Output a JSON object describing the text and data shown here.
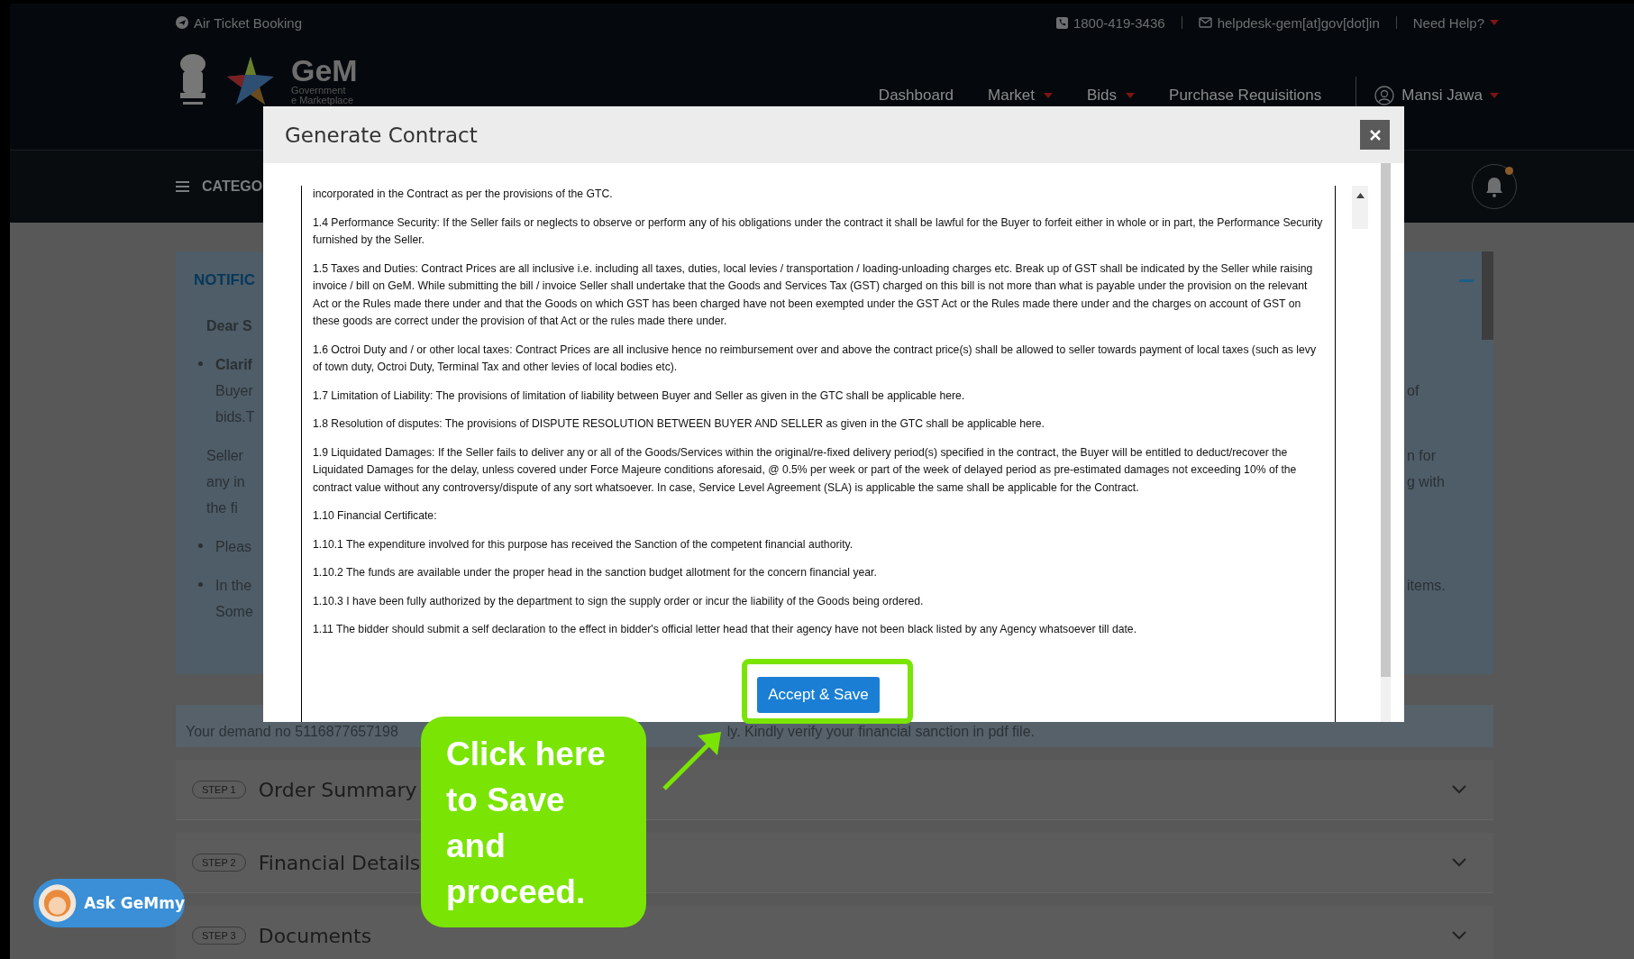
{
  "top_bar": {
    "air_ticket": "Air Ticket Booking",
    "phone": "1800-419-3436",
    "email": "helpdesk-gem[at]gov[dot]in",
    "help": "Need Help?"
  },
  "logo": {
    "name": "GeM",
    "line_1": "Government",
    "line_2": "e Marketplace"
  },
  "nav": [
    {
      "label": "Dashboard",
      "dropdown": false
    },
    {
      "label": "Market",
      "dropdown": true
    },
    {
      "label": "Bids",
      "dropdown": true
    },
    {
      "label": "Purchase Requisitions",
      "dropdown": false
    }
  ],
  "user": {
    "name": "Mansi Jawa"
  },
  "category_bar": {
    "label": "CATEGO"
  },
  "notifications": {
    "title": "NOTIFIC",
    "items": [
      {
        "kind": "greeting",
        "lines": [
          {
            "left": "Dear S"
          }
        ]
      },
      {
        "kind": "bullet",
        "heading": "Clarif",
        "lines": [
          {
            "left": "Buyer",
            "right": "of"
          },
          {
            "left": "bids.T"
          }
        ]
      },
      {
        "kind": "paragraph",
        "lines": [
          {
            "left": "Seller",
            "right": "n for"
          },
          {
            "left": "any in",
            "right": "g with"
          },
          {
            "left": "the fi"
          }
        ]
      },
      {
        "kind": "bullet",
        "lines": [
          {
            "left": "Pleas"
          }
        ]
      },
      {
        "kind": "bullet",
        "lines": [
          {
            "left": "In the",
            "right": "items."
          },
          {
            "left": "Some"
          }
        ]
      }
    ]
  },
  "demand": {
    "start": "Your demand no 5116877657198",
    "end": "ly. Kindly verify your financial sanction in pdf file."
  },
  "steps": [
    {
      "step": "STEP 1",
      "title": "Order Summary"
    },
    {
      "step": "STEP 2",
      "title": "Financial Details"
    },
    {
      "step": "STEP 3",
      "title": "Documents"
    }
  ],
  "assistant": {
    "label": "Ask GeMmy"
  },
  "modal": {
    "title": "Generate Contract",
    "paragraphs": [
      "incorporated in the Contract as per the provisions of the GTC.",
      "1.4 Performance Security: If the Seller fails or neglects to observe or perform any of his obligations under the contract it shall be lawful for the Buyer to forfeit either in whole or in part, the Performance Security furnished by the Seller.",
      "1.5 Taxes and Duties: Contract Prices are all inclusive i.e. including all taxes, duties, local levies / transportation / loading-unloading charges etc. Break up of GST shall be indicated by the Seller while raising invoice / bill on GeM. While submitting the bill / invoice Seller shall undertake that the Goods and Services Tax (GST) charged on this bill is not more than what is payable under the provision on the relevant Act or the Rules made there under and that the Goods on which GST has been charged have not been exempted under the GST Act or the Rules made there under and the charges on account of GST on these goods are correct under the provision of that Act or the rules made there under.",
      "1.6 Octroi Duty and / or other local taxes: Contract Prices are all inclusive hence no reimbursement over and above the contract price(s) shall be allowed to seller towards payment of local taxes (such as levy of town duty, Octroi Duty, Terminal Tax and other levies of local bodies etc).",
      "1.7 Limitation of Liability: The provisions of limitation of liability between Buyer and Seller as given in the GTC shall be applicable here.",
      "1.8 Resolution of disputes: The provisions of DISPUTE RESOLUTION BETWEEN BUYER AND SELLER as given in the GTC shall be applicable here.",
      "1.9 Liquidated Damages: If the Seller fails to deliver any or all of the Goods/Services within the original/re-fixed delivery period(s) specified in the contract, the Buyer will be entitled to deduct/recover the Liquidated Damages for the delay, unless covered under Force Majeure conditions aforesaid, @ 0.5% per week or part of the week of delayed period as pre-estimated damages not exceeding 10% of the contract value without any controversy/dispute of any sort whatsoever. In case, Service Level Agreement (SLA) is applicable the same shall be applicable for the Contract.",
      "1.10 Financial Certificate:",
      "1.10.1 The expenditure involved for this purpose has received the Sanction of the competent financial authority.",
      "1.10.2 The funds are available under the proper head in the sanction budget allotment for the concern financial year.",
      "1.10.3 I have been fully authorized by the department to sign the supply order or incur the liability of the Goods being ordered.",
      "1.11 The bidder should submit a self declaration to the effect in bidder's official letter head that their agency have not been black listed by any Agency whatsoever till date."
    ],
    "button": "Accept & Save"
  },
  "callout": {
    "text": "Click here to Save and proceed."
  }
}
